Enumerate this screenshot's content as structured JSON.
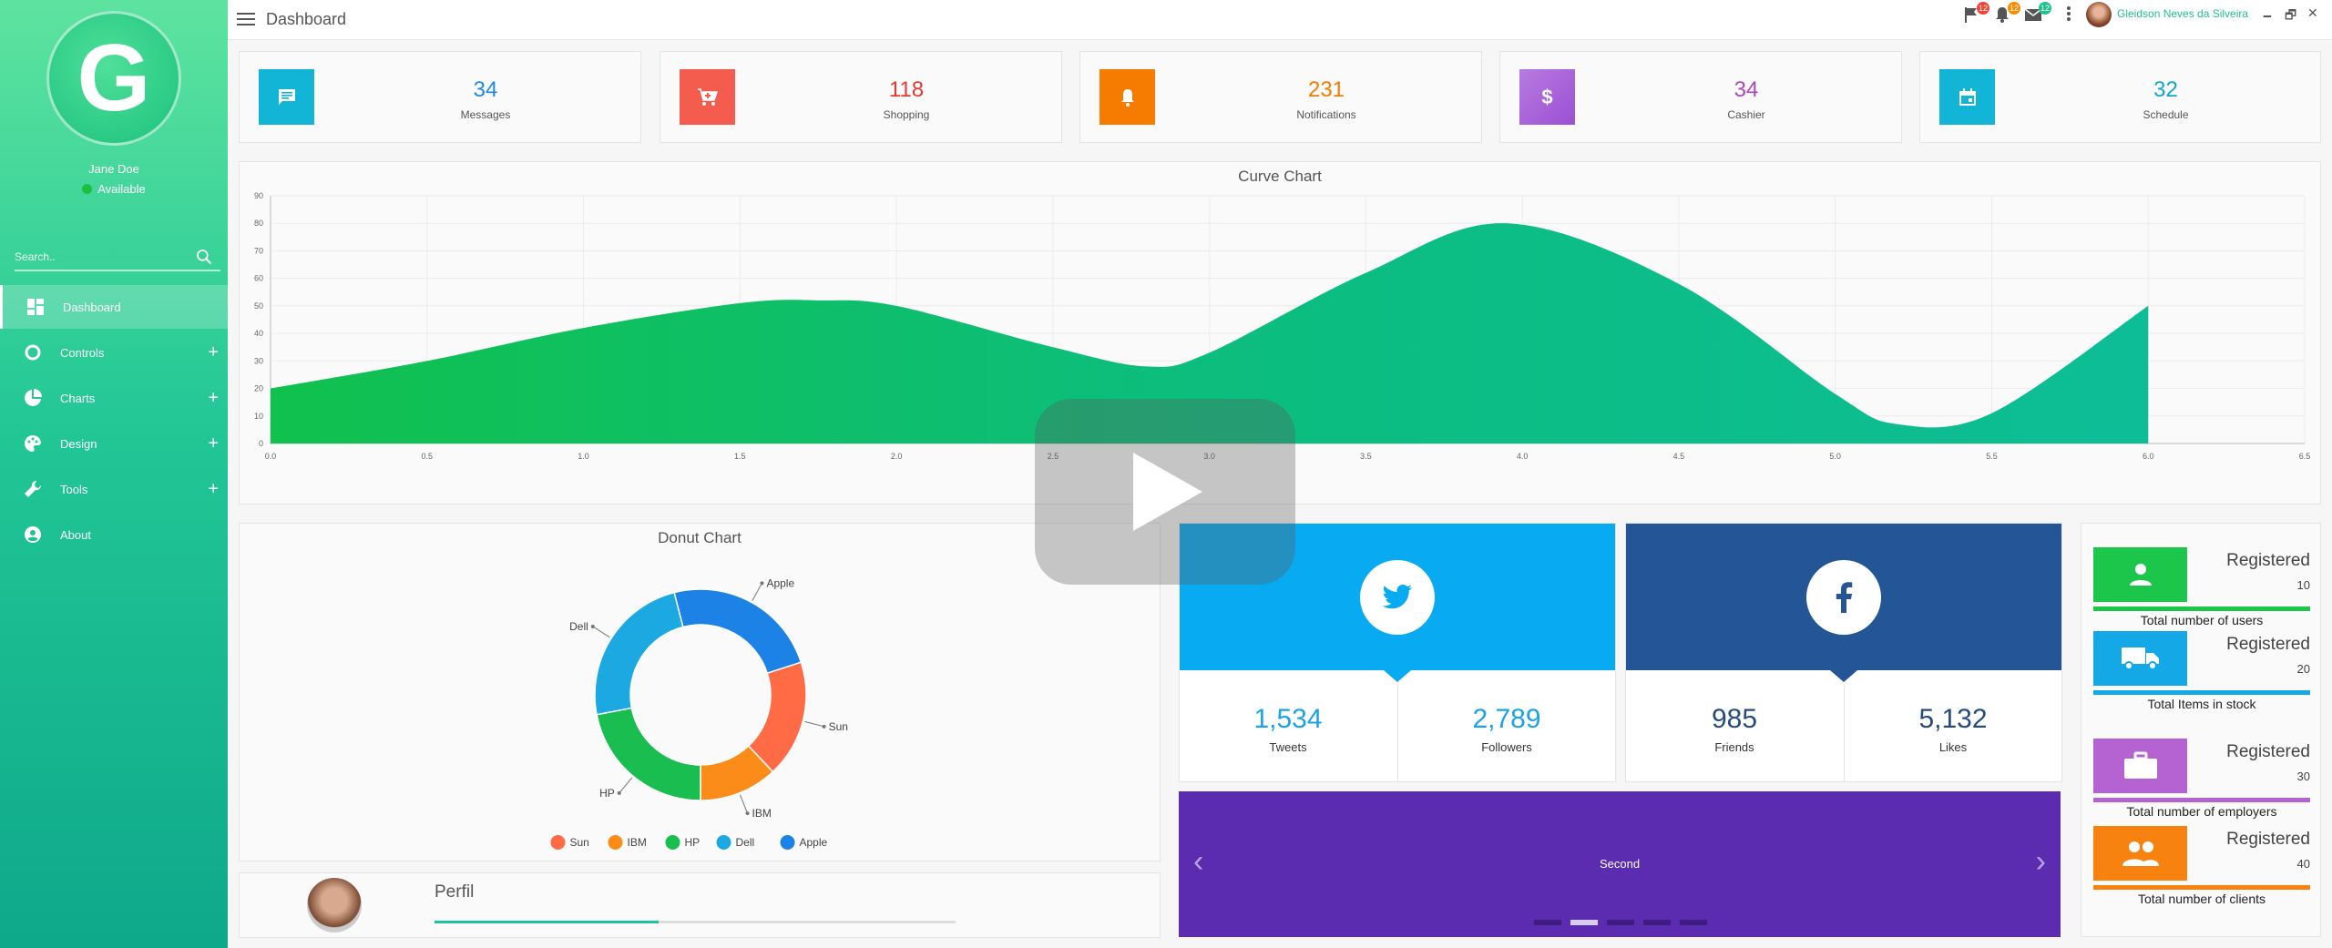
{
  "sidebar": {
    "logo_letter": "G",
    "user_name": "Jane Doe",
    "status": "Available",
    "search_placeholder": "Search..",
    "items": [
      {
        "label": "Dashboard",
        "icon": "dashboard-icon"
      },
      {
        "label": "Controls",
        "icon": "circle-icon"
      },
      {
        "label": "Charts",
        "icon": "pie-chart-icon"
      },
      {
        "label": "Design",
        "icon": "palette-icon"
      },
      {
        "label": "Tools",
        "icon": "wrench-icon"
      },
      {
        "label": "About",
        "icon": "account-icon"
      }
    ],
    "expand_symbol": "+"
  },
  "topbar": {
    "title": "Dashboard",
    "flag_badge": "12",
    "bell_badge": "12",
    "mail_badge": "12",
    "user_name": "Gleidson Neves da Silveira",
    "minimize": "🗕",
    "restore": "🗗",
    "close": "✕"
  },
  "stats": [
    {
      "value": "34",
      "label": "Messages",
      "color": "#12b5d6",
      "icon": "message-icon"
    },
    {
      "value": "118",
      "label": "Shopping",
      "color": "#f45c4e",
      "icon": "cart-icon"
    },
    {
      "value": "231",
      "label": "Notifications",
      "color": "#f57c00",
      "icon": "bell-icon"
    },
    {
      "value": "34",
      "label": "Cashier",
      "color": "#b05fd6",
      "icon": "dollar-icon"
    },
    {
      "value": "32",
      "label": "Schedule",
      "color": "#12b5d6",
      "icon": "calendar-icon"
    }
  ],
  "curve_chart_title": "Curve Chart",
  "donut_chart_title": "Donut Chart",
  "chart_data": [
    {
      "type": "area",
      "title": "Curve Chart",
      "x": [
        0,
        0.5,
        1.0,
        1.5,
        1.75,
        2.0,
        2.5,
        2.8,
        3.0,
        3.5,
        3.95,
        4.5,
        5.0,
        5.2,
        5.5,
        6.0
      ],
      "y": [
        20,
        30,
        42,
        51,
        52,
        50,
        35,
        28,
        33,
        62,
        80,
        58,
        18,
        7,
        11,
        50
      ],
      "xlim": [
        0,
        6.5
      ],
      "ylim": [
        0,
        90
      ],
      "xticks": [
        "0.0",
        "0.5",
        "1.0",
        "1.5",
        "2.0",
        "2.5",
        "3.0",
        "3.5",
        "4.0",
        "4.5",
        "5.0",
        "5.5",
        "6.0",
        "6.5"
      ],
      "yticks": [
        "0",
        "10",
        "20",
        "30",
        "40",
        "50",
        "60",
        "70",
        "80",
        "90"
      ],
      "grid": true
    },
    {
      "type": "pie",
      "title": "Donut Chart",
      "categories": [
        "Sun",
        "IBM",
        "HP",
        "Dell",
        "Apple"
      ],
      "values": [
        18,
        12,
        22,
        24,
        24
      ],
      "colors": [
        "#ff6b45",
        "#fb8c1a",
        "#19bd50",
        "#1ca9e1",
        "#1c82e6"
      ],
      "legend": "bottom"
    }
  ],
  "twitter": {
    "tweets": "1,534",
    "tweets_label": "Tweets",
    "followers": "2,789",
    "followers_label": "Followers",
    "color": "#08aaf2"
  },
  "facebook": {
    "friends": "985",
    "friends_label": "Friends",
    "likes": "5,132",
    "likes_label": "Likes",
    "color": "#235597"
  },
  "carousel": {
    "text": "Second",
    "active_index": 1,
    "count": 5,
    "prev": "‹",
    "next": "›"
  },
  "registered": [
    {
      "title": "Registered",
      "count": "10",
      "desc": "Total number of users",
      "color": "#1cc64a",
      "icon": "person-icon"
    },
    {
      "title": "Registered",
      "count": "20",
      "desc": "Total Items in stock",
      "color": "#14a9e6",
      "icon": "truck-icon"
    },
    {
      "title": "Registered",
      "count": "30",
      "desc": "Total number of employers",
      "color": "#b563d3",
      "icon": "briefcase-icon"
    },
    {
      "title": "Registered",
      "count": "40",
      "desc": "Total number of clients",
      "color": "#f7820f",
      "icon": "group-icon"
    }
  ],
  "perfil": {
    "title": "Perfil",
    "progress": 0.43
  }
}
